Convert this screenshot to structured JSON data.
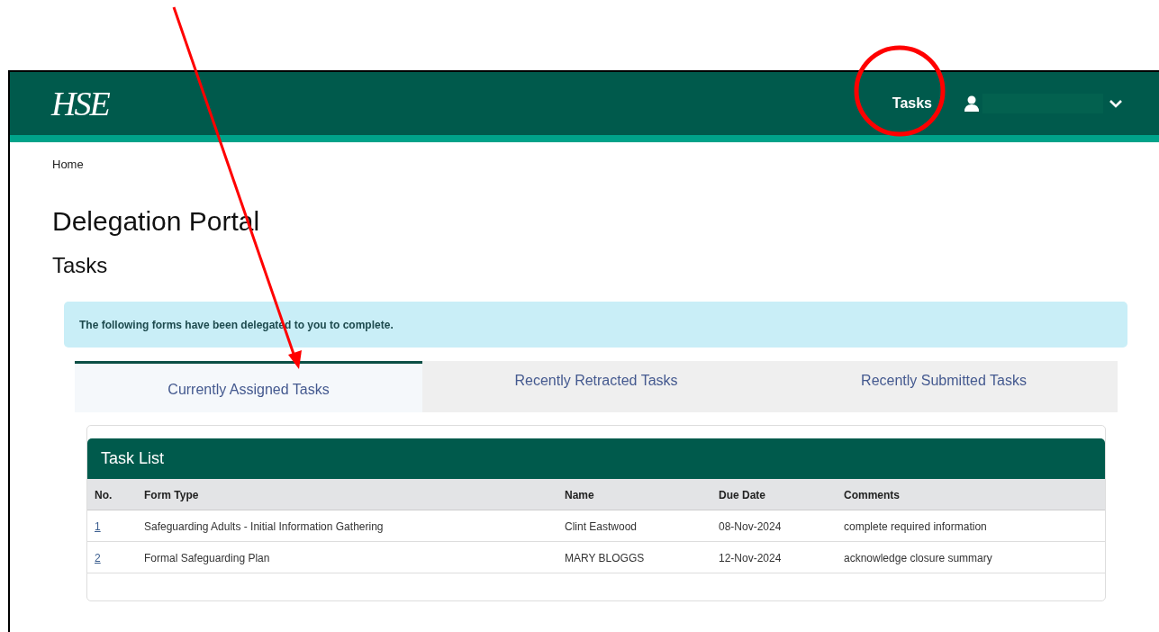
{
  "header": {
    "logo": "HSE",
    "nav": [
      {
        "label": "Tasks"
      }
    ]
  },
  "breadcrumb": [
    "Home"
  ],
  "title": "Delegation Portal",
  "subtitle": "Tasks",
  "alert": "The following forms have been delegated to you to complete.",
  "tabs": [
    {
      "label": "Currently Assigned Tasks",
      "selected": true
    },
    {
      "label": "Recently Retracted Tasks",
      "selected": false
    },
    {
      "label": "Recently Submitted Tasks",
      "selected": false
    }
  ],
  "task_list": {
    "title": "Task List",
    "columns": [
      "No.",
      "Form Type",
      "Name",
      "Due Date",
      "Comments"
    ],
    "rows": [
      {
        "no": "1",
        "form_type": "Safeguarding Adults - Initial Information Gathering",
        "name": "Clint Eastwood",
        "due_date": "08-Nov-2024",
        "comments": "complete required information"
      },
      {
        "no": "2",
        "form_type": "Formal Safeguarding Plan",
        "name": "MARY BLOGGS",
        "due_date": "12-Nov-2024",
        "comments": "acknowledge closure summary"
      }
    ]
  },
  "annotations": {
    "arrow": {
      "color": "#ff0000"
    },
    "circle": {
      "color": "#ff0000"
    }
  }
}
